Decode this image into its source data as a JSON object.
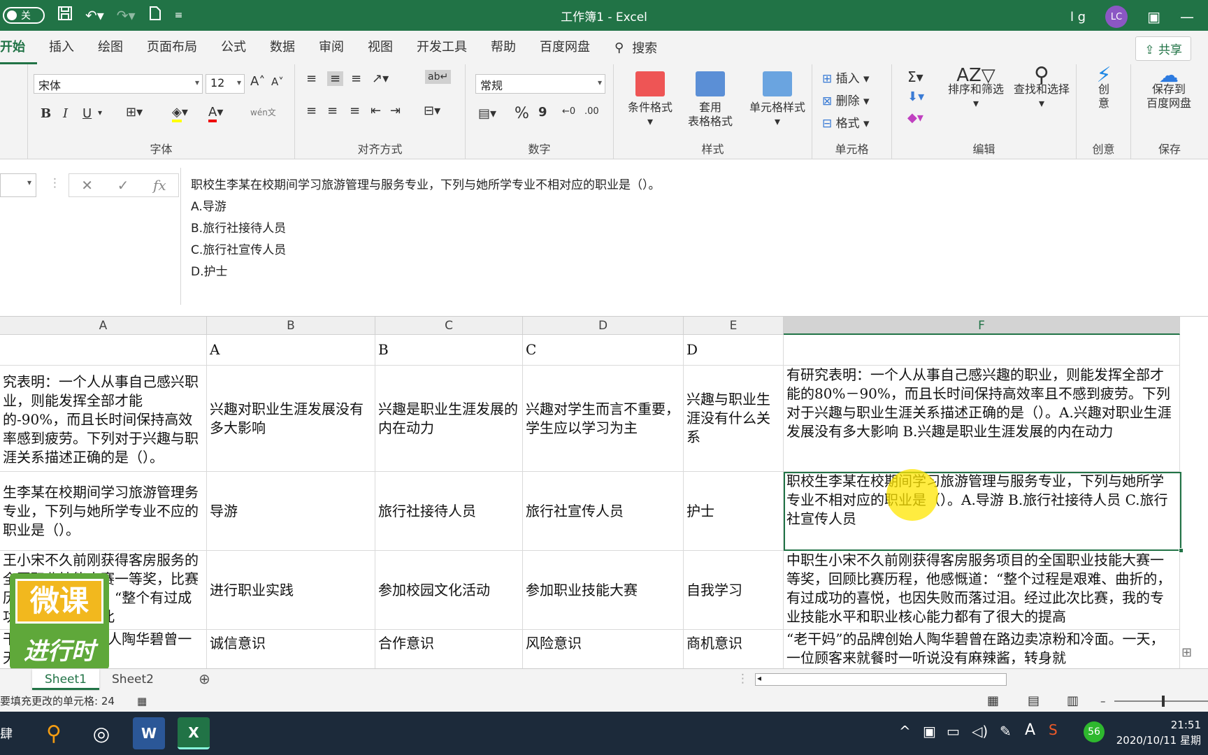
{
  "titlebar": {
    "toggle_label": "关",
    "title": "工作簿1 - Excel",
    "user": "l g",
    "avatar_initials": "LC"
  },
  "tabs": [
    "开始",
    "插入",
    "绘图",
    "页面布局",
    "公式",
    "数据",
    "审阅",
    "视图",
    "开发工具",
    "帮助",
    "百度网盘"
  ],
  "search_label": "搜索",
  "share_label": "共享",
  "ribbon": {
    "font_name": "宋体",
    "font_size": "12",
    "number_format": "常规",
    "groups": {
      "font": "字体",
      "alignment": "对齐方式",
      "number": "数字",
      "styles": "样式",
      "cells": "单元格",
      "editing": "编辑",
      "ideas": "创意",
      "save": "保存"
    },
    "styles": {
      "conditional": "条件格式",
      "table_line1": "套用",
      "table_line2": "表格格式",
      "cell_styles": "单元格样式"
    },
    "cells": {
      "insert": "插入",
      "delete": "删除",
      "format": "格式"
    },
    "editing": {
      "sort": "排序和筛选",
      "find": "查找和选择"
    },
    "ideas_line1": "创",
    "ideas_line2": "意",
    "save_line1": "保存到",
    "save_line2": "百度网盘",
    "font_buttons": {
      "bold": "B",
      "italic": "I",
      "underline": "U",
      "font_color": "A",
      "phonetic": "wén文"
    },
    "number_buttons": {
      "percent": "%",
      "comma": "9"
    }
  },
  "formula_bar": {
    "fx": "fx",
    "lines": [
      "职校生李某在校期间学习旅游管理与服务专业，下列与她所学专业不相对应的职业是（）。",
      "A.导游",
      "B.旅行社接待人员",
      "C.旅行社宣传人员",
      "D.护士"
    ]
  },
  "columns": [
    "A",
    "B",
    "C",
    "D",
    "E",
    "F"
  ],
  "rows": [
    {
      "a": "",
      "b": "A",
      "c": "B",
      "d": "C",
      "e": "D",
      "f": ""
    },
    {
      "a": "究表明：一个人从事自己感兴职业，则能发挥全部才能的-90%，而且长时间保持高效率感到疲劳。下列对于兴趣与职涯关系描述正确的是（）。",
      "b": "兴趣对职业生涯发展没有多大影响",
      "c": "兴趣是职业生涯发展的内在动力",
      "d": "兴趣对学生而言不重要，学生应以学习为主",
      "e": "兴趣与职业生涯没有什么关系",
      "f": "有研究表明：一个人从事自己感兴趣的职业，则能发挥全部才能的80%－90%，而且长时间保持高效率且不感到疲劳。下列对于兴趣与职业生涯关系描述正确的是（）。A.兴趣对职业生涯发展没有多大影响 B.兴趣是职业生涯发展的内在动力"
    },
    {
      "a": "生李某在校期间学习旅游管理务专业，下列与她所学专业不应的职业是（）。",
      "b": "导游",
      "c": "旅行社接待人员",
      "d": "旅行社宣传人员",
      "e": "护士",
      "f": "职校生李某在校期间学习旅游管理与服务专业，下列与她所学专业不相对应的职业是（）。A.导游 B.旅行社接待人员 C.旅行社宣传人员"
    },
    {
      "a": "王小宋不久前刚获得客房服务的全国职业技能大赛一等奖，比赛历程，他感慨道：“整个有过成功的喜悦，经过此",
      "b": "进行职业实践",
      "c": "参加校园文化活动",
      "d": "参加职业技能大赛",
      "e": "自我学习",
      "f": "中职生小宋不久前刚获得客房服务项目的全国职业技能大赛一等奖，回顾比赛历程，他感慨道：“整个过程是艰难、曲折的，有过成功的喜悦，也因失败而落过泪。经过此次比赛，我的专业技能水平和职业核心能力都有了很大的提高"
    },
    {
      "a": "干妈”的品牌创始人陶华碧曾一天，一位",
      "b": "诚信意识",
      "c": "合作意识",
      "d": "风险意识",
      "e": "商机意识",
      "f": "“老干妈”的品牌创始人陶华碧曾在路边卖凉粉和冷面。一天，一位顾客来就餐时一听说没有麻辣酱，转身就"
    }
  ],
  "sheets": [
    "Sheet1",
    "Sheet2"
  ],
  "status_text": "要填充更改的单元格: 24",
  "taskbar": {
    "time": "21:51",
    "date": "2020/10/11 星期",
    "badge": "56",
    "lang": "A",
    "word": "W",
    "excel": "X",
    "left_text": "肆"
  },
  "logo": {
    "line1": "微课",
    "line2": "进行时"
  }
}
